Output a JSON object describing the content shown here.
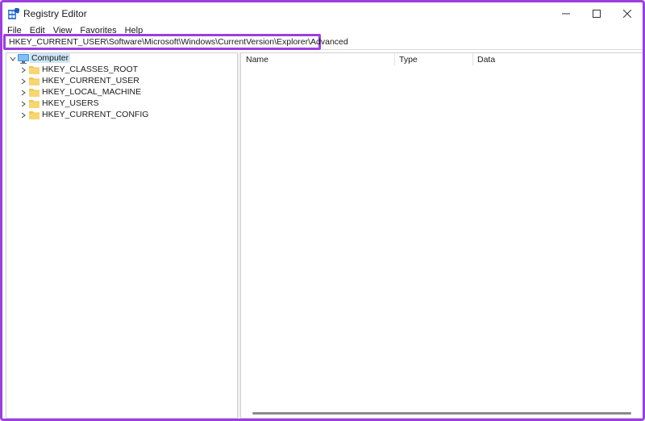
{
  "window": {
    "title": "Registry Editor"
  },
  "menu": [
    "File",
    "Edit",
    "View",
    "Favorites",
    "Help"
  ],
  "address": {
    "path": "HKEY_CURRENT_USER\\Software\\Microsoft\\Windows\\CurrentVersion\\Explorer\\Advanced"
  },
  "tree": {
    "root": {
      "label": "Computer",
      "icon": "computer-icon",
      "expanded": true,
      "selected": true
    },
    "children": [
      {
        "label": "HKEY_CLASSES_ROOT",
        "icon": "folder-icon"
      },
      {
        "label": "HKEY_CURRENT_USER",
        "icon": "folder-icon"
      },
      {
        "label": "HKEY_LOCAL_MACHINE",
        "icon": "folder-icon"
      },
      {
        "label": "HKEY_USERS",
        "icon": "folder-icon"
      },
      {
        "label": "HKEY_CURRENT_CONFIG",
        "icon": "folder-icon"
      }
    ]
  },
  "list": {
    "columns": [
      "Name",
      "Type",
      "Data"
    ]
  },
  "colors": {
    "highlight": "#9b3fe0",
    "selection": "#cde6f7",
    "folder": "#f3c451"
  }
}
